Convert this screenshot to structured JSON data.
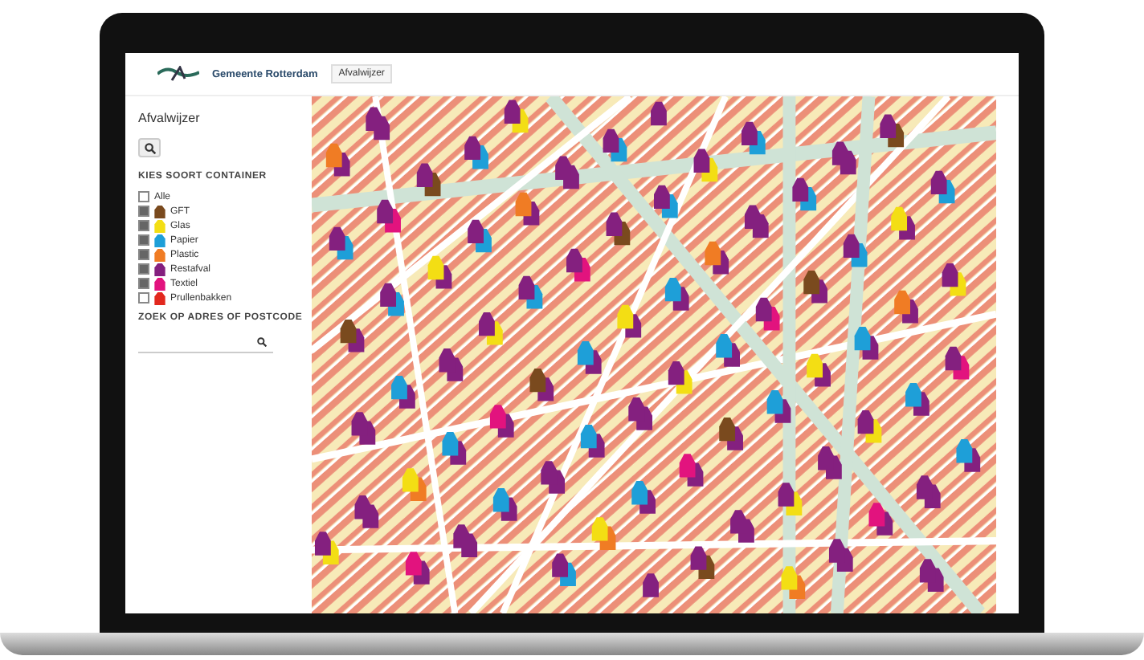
{
  "header": {
    "brand": "Gemeente Rotterdam",
    "tab": "Afvalwijzer"
  },
  "sidebar": {
    "title": "Afvalwijzer",
    "filter_heading": "KIES SOORT CONTAINER",
    "items": [
      {
        "label": "Alle",
        "checked": false
      },
      {
        "label": "GFT",
        "checked": true,
        "color": "#7a4a1e"
      },
      {
        "label": "Glas",
        "checked": true,
        "color": "#f3de14"
      },
      {
        "label": "Papier",
        "checked": true,
        "color": "#1e9fd8"
      },
      {
        "label": "Plastic",
        "checked": true,
        "color": "#f07c24"
      },
      {
        "label": "Restafval",
        "checked": true,
        "color": "#84207f"
      },
      {
        "label": "Textiel",
        "checked": true,
        "color": "#e2137e"
      },
      {
        "label": "Prullenbakken",
        "checked": false,
        "color": "#e2281e"
      }
    ],
    "search_heading": "ZOEK OP ADRES OF POSTCODE"
  }
}
